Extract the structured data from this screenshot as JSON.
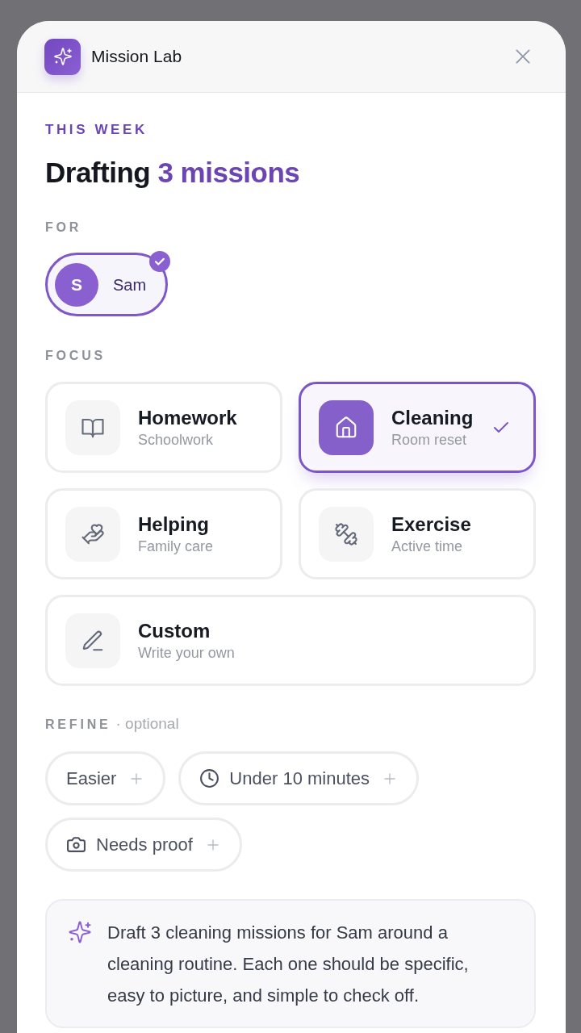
{
  "header": {
    "title": "Mission Lab"
  },
  "eyebrow": "THIS WEEK",
  "heading": {
    "lead": "Drafting",
    "highlight": "3 missions"
  },
  "for_section": {
    "label": "FOR",
    "people": [
      {
        "initial": "S",
        "name": "Sam",
        "selected": true
      }
    ]
  },
  "focus_section": {
    "label": "FOCUS",
    "options": [
      {
        "kind": "book",
        "title": "Homework",
        "subtitle": "Schoolwork",
        "selected": false
      },
      {
        "kind": "house",
        "title": "Cleaning",
        "subtitle": "Room reset",
        "selected": true
      },
      {
        "kind": "hand",
        "title": "Helping",
        "subtitle": "Family care",
        "selected": false
      },
      {
        "kind": "dumbbell",
        "title": "Exercise",
        "subtitle": "Active time",
        "selected": false
      },
      {
        "kind": "pencil",
        "title": "Custom",
        "subtitle": "Write your own",
        "selected": false
      }
    ]
  },
  "refine_section": {
    "label": "REFINE",
    "note": "· optional",
    "chips": [
      {
        "kind": "plain",
        "label": "Easier",
        "selected": false
      },
      {
        "kind": "clock",
        "label": "Under 10 minutes",
        "selected": false
      },
      {
        "kind": "camera",
        "label": "Needs proof",
        "selected": false
      }
    ]
  },
  "prompt": {
    "text": "Draft 3 cleaning missions for Sam around a cleaning routine. Each one should be specific, easy to picture, and simple to check off."
  }
}
